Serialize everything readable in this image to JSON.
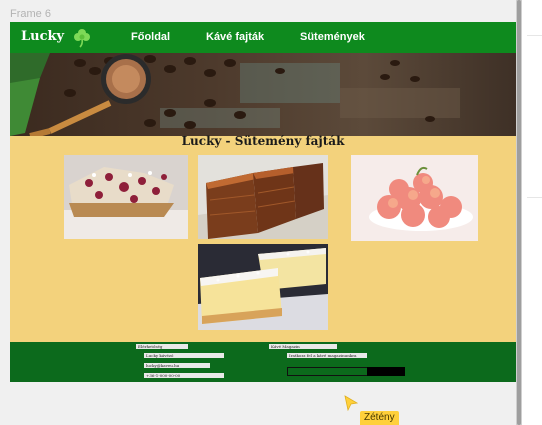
{
  "canvas": {
    "frame_label": "Frame 6"
  },
  "site": {
    "logo": "Lucky",
    "nav": [
      "Főoldal",
      "Kávé fajták",
      "Sütemények"
    ],
    "page_title": "Lucky - Sütemény fajták"
  },
  "gallery": [
    {
      "name": "cake-photo-cranberry"
    },
    {
      "name": "cake-photo-honey-layer"
    },
    {
      "name": "cake-photo-peach-cookies"
    },
    {
      "name": "cake-photo-cream-slice"
    }
  ],
  "footer": {
    "col1": [
      "Elérhetőség",
      "Lucky kávézó",
      "lucky@kaveu.hu",
      "+36-1-000-00-00"
    ],
    "col2": [
      "Kávé Magazin",
      "Iratkozz fel a kávé magazinunkra"
    ]
  },
  "collaborator": {
    "name": "Zétény"
  },
  "colors": {
    "nav": "#0e8a1e",
    "body": "#f3d27c",
    "footer": "#0c6a1c",
    "cursor": "#ffd03b"
  }
}
